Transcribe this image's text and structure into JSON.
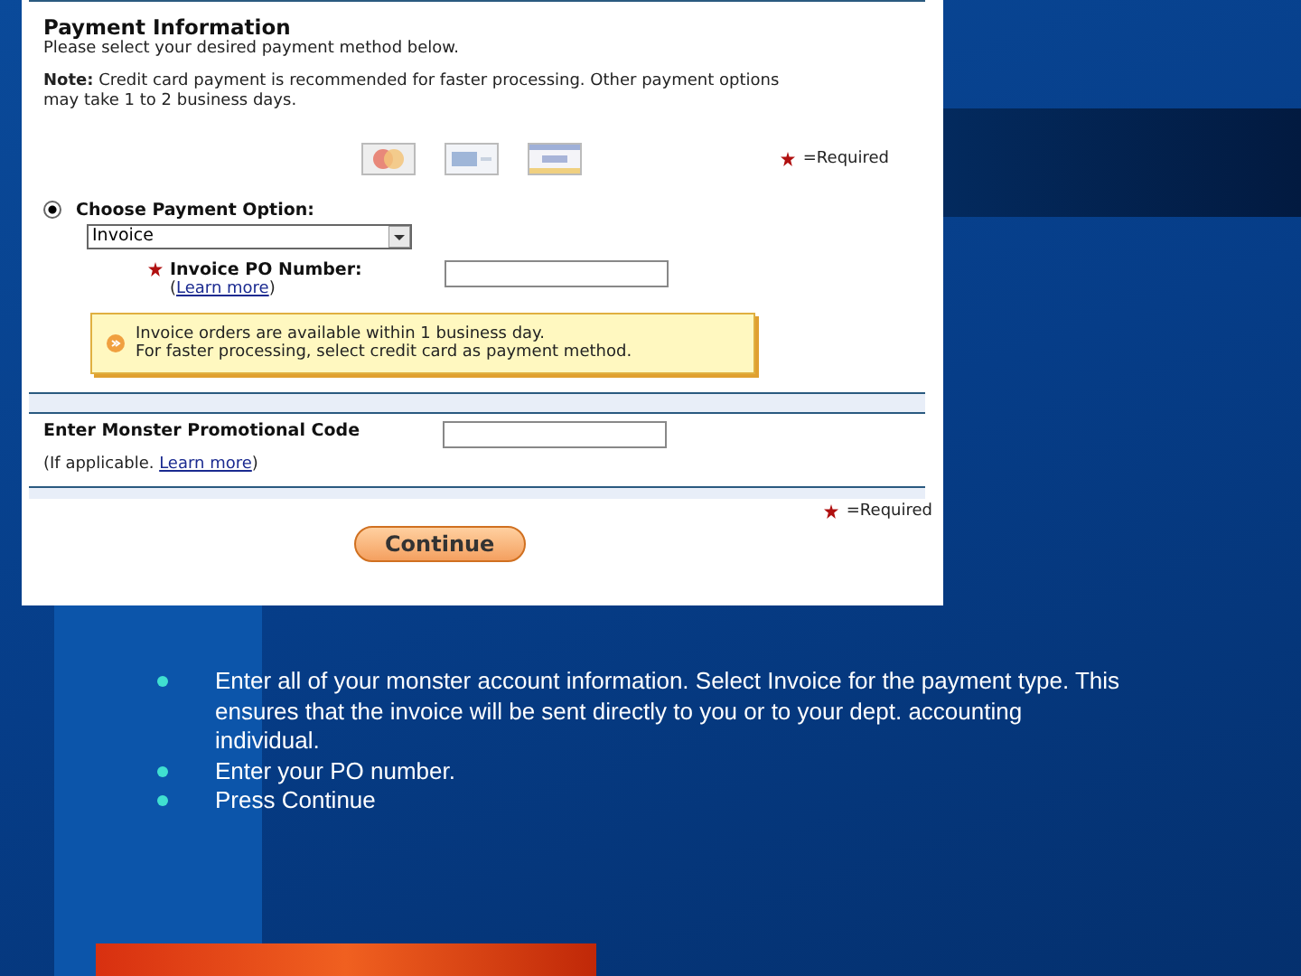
{
  "form": {
    "title": "Payment Information",
    "intro": "Please select your desired payment method below.",
    "note": "**Note:** Credit card payment is recommended for faster processing. Other payment options may take 1 to 2 business days.",
    "required_top": "=Required",
    "payment_option": {
      "label": "Choose Payment Option:",
      "selected": true,
      "value": "Invoice"
    },
    "po_number": {
      "label": "Invoice PO Number:",
      "open": "(",
      "learn_more": "Learn more",
      "close": ")"
    },
    "alert": [
      "Invoice orders are available within 1 business day.",
      "For faster processing, select credit card as payment method."
    ],
    "promo": {
      "label": "Enter Monster Promotional Code",
      "hint": "(If applicable.",
      "learn_more": "Learn more",
      "close": ")"
    },
    "required_bottom": "=Required",
    "button": "Continue"
  },
  "bullets": [
    "Enter all of your monster account information.  Select Invoice for the payment type. This ensures that the invoice will be sent directly to you or to your dept. accounting individual.",
    "Enter your PO number.",
    "Press Continue"
  ]
}
